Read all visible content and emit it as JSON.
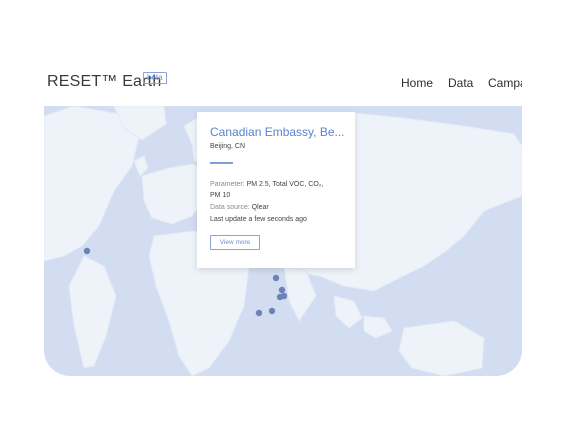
{
  "header": {
    "logo": "RESET™ Earth",
    "beta": "beta",
    "nav": [
      "Home",
      "Data",
      "Campaigns"
    ]
  },
  "map": {
    "marker_color": "#6c82b8",
    "water_color": "#d3ddf1",
    "land_color": "#eef2f9"
  },
  "card": {
    "title": "Canadian Embassy, Be...",
    "location": "Beijing, CN",
    "parameter_key": "Parameter:",
    "parameter_value": "PM 2.5, Total VOC, CO₂,",
    "parameter_value_2": "PM 10",
    "source_key": "Data source:",
    "source_value": "Qlear",
    "update": "Last update a few seconds ago",
    "button": "View more"
  }
}
